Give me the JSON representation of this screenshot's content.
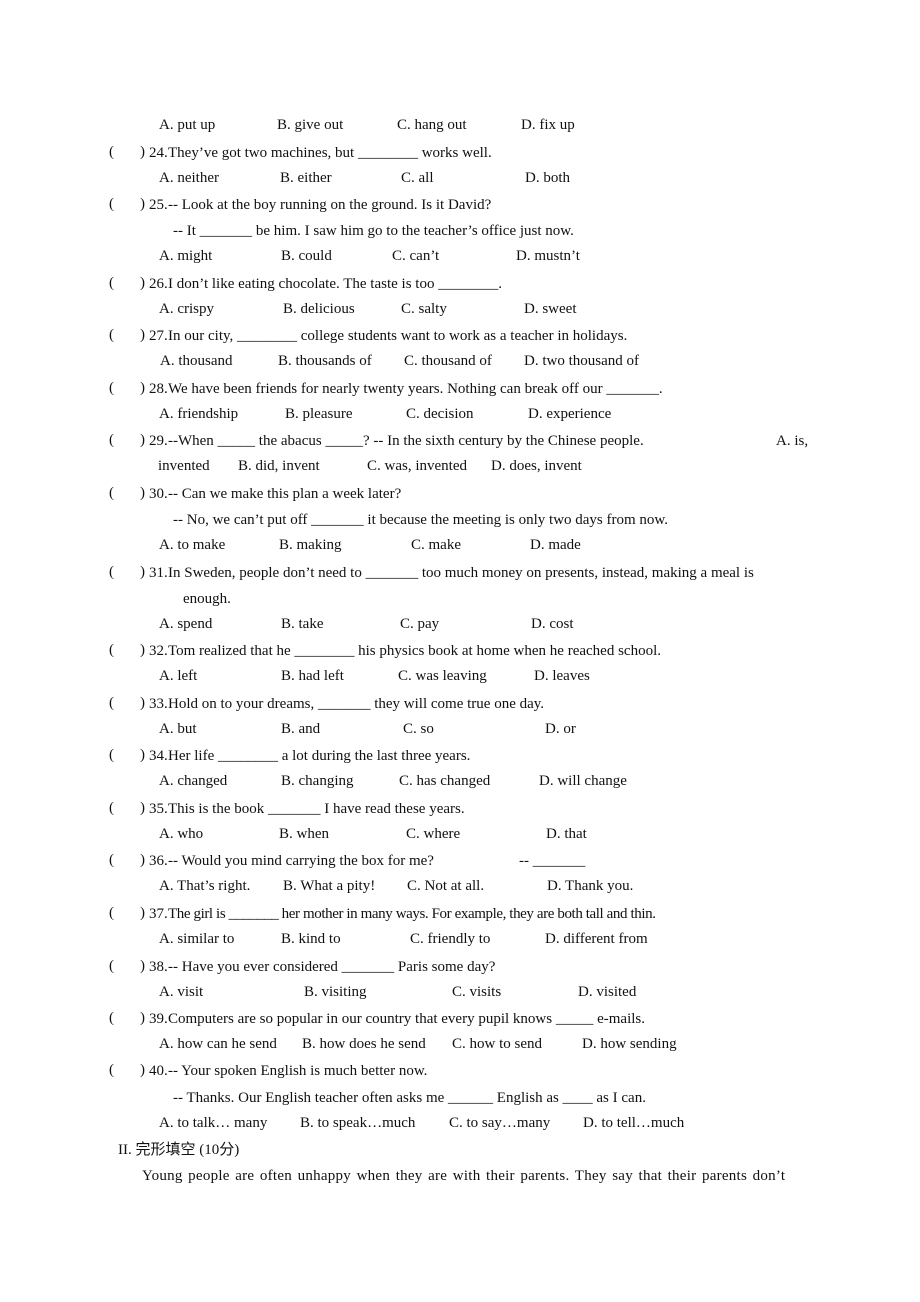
{
  "questions": [
    {
      "num": "24",
      "stem": "They’ve got two machines, but ________ works well.",
      "options": [
        "A. neither",
        "B. either",
        "C. all",
        "D. both"
      ]
    },
    {
      "num": "25",
      "stem": "-- Look at the boy running on the ground. Is it David?",
      "stem2": "-- It _______ be him. I saw him go to the teacher’s office just now.",
      "options": [
        "A. might",
        "B. could",
        "C. can’t",
        "D. mustn’t"
      ]
    },
    {
      "num": "26",
      "stem": "I don’t like eating chocolate. The taste is too ________.",
      "options": [
        "A. crispy",
        "B. delicious",
        "C. salty",
        "D. sweet"
      ]
    },
    {
      "num": "27",
      "stem": "In our city, ________ college students want to work as a teacher in holidays.",
      "options": [
        "A. thousand",
        "B. thousands of",
        "C. thousand of",
        "D. two thousand of"
      ]
    },
    {
      "num": "28",
      "stem": "We have been friends for nearly twenty years. Nothing can break off our _______.",
      "options": [
        "A. friendship",
        "B. pleasure",
        "C. decision",
        "D. experience"
      ]
    },
    {
      "num": "29",
      "stem": "--When _____ the abacus _____?      -- In the sixth century by the Chinese people.",
      "stem_tail": "A. is,",
      "options": [
        "invented",
        "B. did, invent",
        "C. was, invented",
        "D. does, invent"
      ]
    },
    {
      "num": "30",
      "stem": "-- Can we make this plan a week later?",
      "stem2": "-- No, we can’t put off _______ it because the meeting is only two days from now.",
      "options": [
        "A. to make",
        "B. making",
        "C. make",
        "D. made"
      ]
    },
    {
      "num": "31",
      "stem": "In Sweden, people don’t need to _______ too much money on presents, instead, making a meal is",
      "stem2": "enough.",
      "options": [
        "A. spend",
        "B. take",
        "C. pay",
        "D. cost"
      ]
    },
    {
      "num": "32",
      "stem": "Tom realized that he ________ his physics book at home when he reached school.",
      "options": [
        "A. left",
        "B. had left",
        "C. was leaving",
        "D. leaves"
      ]
    },
    {
      "num": "33",
      "stem": "Hold on to your dreams, _______ they will come true one day.",
      "options": [
        "A. but",
        "B. and",
        "C. so",
        "D. or"
      ]
    },
    {
      "num": "34",
      "stem": "Her life ________ a lot during the last three years.",
      "options": [
        "A. changed",
        "B. changing",
        "C. has changed",
        "D. will change"
      ]
    },
    {
      "num": "35",
      "stem": "This is the book _______ I have read these years.",
      "options": [
        "A. who",
        "B. when",
        "C. where",
        "D. that"
      ]
    },
    {
      "num": "36",
      "stem": "-- Would you mind carrying the box for me?",
      "stem_tail": "-- _______",
      "options": [
        "A. That’s right.",
        "B. What a pity!",
        "C. Not at all.",
        "D. Thank you."
      ]
    },
    {
      "num": "37",
      "stem": "The girl is _______ her mother in many ways. For example, they are both tall and thin.",
      "options": [
        "A. similar to",
        "B. kind to",
        "C. friendly to",
        "D. different from"
      ]
    },
    {
      "num": "38",
      "stem": "-- Have you ever considered _______ Paris some day?",
      "options": [
        "A. visit",
        "B. visiting",
        "C. visits",
        "D. visited"
      ]
    },
    {
      "num": "39",
      "stem": "Computers are so popular in our country that every pupil knows _____ e-mails.",
      "options": [
        "A. how can he send",
        "B. how does he send",
        "C. how to send",
        "D. how sending"
      ]
    },
    {
      "num": "40",
      "stem": "-- Your spoken English is much better now.",
      "stem2": "-- Thanks. Our English teacher often asks me ______ English as ____ as I can.",
      "options": [
        "A. to talk… many",
        "B. to speak…much",
        "C. to say…many",
        "D. to tell…much"
      ]
    }
  ],
  "q23_options": [
    "A. put up",
    "B. give out",
    "C. hang out",
    "D. fix up"
  ],
  "paren_open": "(",
  "paren_close": ")",
  "section2": {
    "heading": "II.  完形填空  (10分)",
    "first_line": "Young people are often unhappy when they are with their parents. They say that their parents don’t"
  }
}
